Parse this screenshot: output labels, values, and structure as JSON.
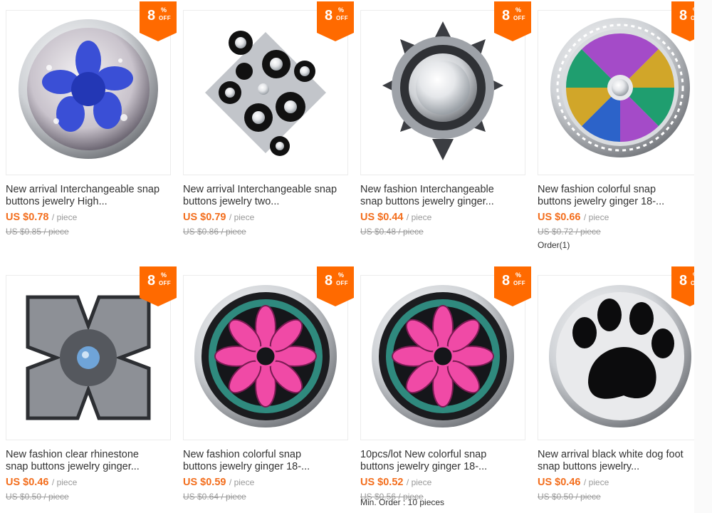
{
  "products": [
    {
      "badge": {
        "num": "8",
        "pct": "%",
        "off": "OFF"
      },
      "title_l1": "New arrival Interchangeable snap",
      "title_l2": "buttons jewelry High...",
      "price": "US $0.78",
      "unit": "/ piece",
      "original": "US $0.85 / piece",
      "orders": "",
      "icon": "blue-flower-snap"
    },
    {
      "badge": {
        "num": "8",
        "pct": "%",
        "off": "OFF"
      },
      "title_l1": "New arrival Interchangeable snap",
      "title_l2": "buttons jewelry two...",
      "price": "US $0.79",
      "unit": "/ piece",
      "original": "US $0.86 / piece",
      "orders": "",
      "icon": "black-flowers-snap"
    },
    {
      "badge": {
        "num": "8",
        "pct": "%",
        "off": "OFF"
      },
      "title_l1": "New fashion Interchangeable",
      "title_l2": "snap buttons jewelry ginger...",
      "price": "US $0.44",
      "unit": "/ piece",
      "original": "US $0.48 / piece",
      "orders": "",
      "icon": "crystal-sun-snap"
    },
    {
      "badge": {
        "num": "8",
        "pct": "%",
        "off": "OFF"
      },
      "title_l1": "New fashion colorful snap",
      "title_l2": "buttons jewelry ginger 18-...",
      "price": "US $0.66",
      "unit": "/ piece",
      "original": "US $0.72 / piece",
      "orders": "Order(1)",
      "icon": "colorful-wheel-snap"
    },
    {
      "badge": {
        "num": "8",
        "pct": "%",
        "off": "OFF"
      },
      "title_l1": "New fashion clear rhinestone",
      "title_l2": "snap buttons jewelry ginger...",
      "price": "US $0.46",
      "unit": "/ piece",
      "original": "US $0.50 / piece",
      "orders": "",
      "icon": "silver-clover-snap"
    },
    {
      "badge": {
        "num": "8",
        "pct": "%",
        "off": "OFF"
      },
      "title_l1": "New fashion colorful snap",
      "title_l2": "buttons jewelry ginger 18-...",
      "price": "US $0.59",
      "unit": "/ piece",
      "original": "US $0.64 / piece",
      "orders": "",
      "icon": "pink-flower-enamel-snap"
    },
    {
      "badge": {
        "num": "8",
        "pct": "%",
        "off": "OFF"
      },
      "title_l1": "10pcs/lot New colorful snap",
      "title_l2": "buttons jewelry ginger 18-...",
      "price": "US $0.52",
      "unit": "/ piece",
      "original": "US $0.56 / piece",
      "orders": "Min. Order : 10 pieces",
      "icon": "pink-flower-enamel-snap"
    },
    {
      "badge": {
        "num": "8",
        "pct": "%",
        "off": "OFF"
      },
      "title_l1": "New arrival black white dog foot",
      "title_l2": "snap buttons jewelry...",
      "price": "US $0.46",
      "unit": "/ piece",
      "original": "US $0.50 / piece",
      "orders": "",
      "icon": "dog-paw-snap"
    }
  ],
  "colors": {
    "accent": "#f36e1d",
    "badge": "#ff6a00",
    "muted": "#999999"
  }
}
